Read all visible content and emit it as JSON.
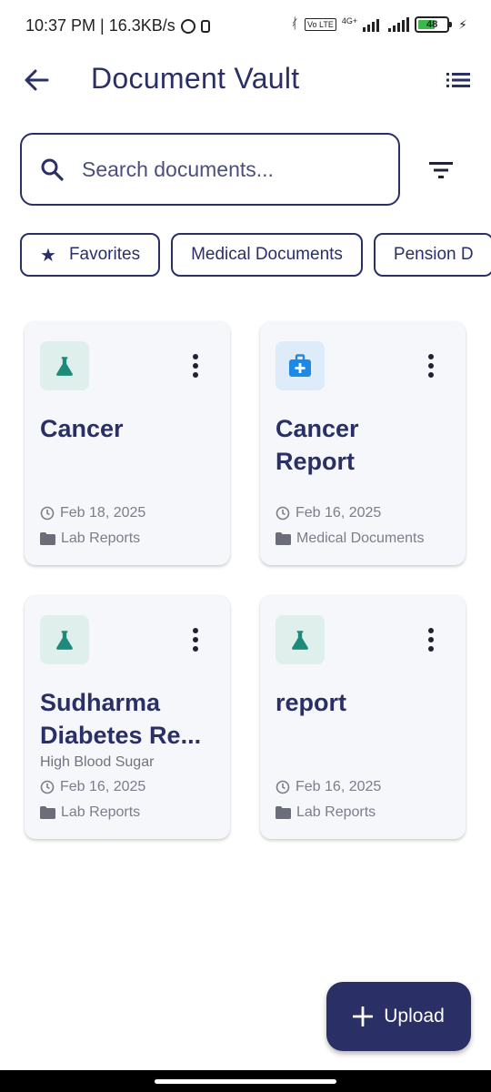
{
  "status_bar": {
    "time_speed": "10:37 PM | 16.3KB/s",
    "network": "4G+",
    "volte": "Vo LTE",
    "battery": "48"
  },
  "header": {
    "title": "Document Vault",
    "back_icon": "arrow-left-icon",
    "menu_icon": "list-icon"
  },
  "search": {
    "placeholder": "Search documents...",
    "value": "",
    "icon": "search-icon",
    "filter_icon": "filter-icon"
  },
  "chips": [
    {
      "label": "Favorites",
      "icon": "star-icon"
    },
    {
      "label": "Medical Documents"
    },
    {
      "label": "Pension D"
    }
  ],
  "documents": [
    {
      "title": "Cancer",
      "subtitle": "",
      "date": "Feb 18, 2025",
      "category": "Lab Reports",
      "icon": "flask-icon",
      "icon_color": "#1e8a7a"
    },
    {
      "title": "Cancer Report",
      "subtitle": "",
      "date": "Feb 16, 2025",
      "category": "Medical Documents",
      "icon": "medical-bag-icon",
      "icon_color": "#1e88e5"
    },
    {
      "title": "Sudharma Diabetes Re...",
      "subtitle": "High Blood Sugar",
      "date": "Feb 16, 2025",
      "category": "Lab Reports",
      "icon": "flask-icon",
      "icon_color": "#1e8a7a"
    },
    {
      "title": "report",
      "subtitle": "",
      "date": "Feb 16, 2025",
      "category": "Lab Reports",
      "icon": "flask-icon",
      "icon_color": "#1e8a7a"
    }
  ],
  "fab": {
    "label": "Upload",
    "icon": "plus-icon"
  },
  "colors": {
    "primary": "#2a2f66",
    "card_bg": "#f6f7fb",
    "lab_tint": "#dfefec",
    "med_tint": "#deebf8"
  }
}
